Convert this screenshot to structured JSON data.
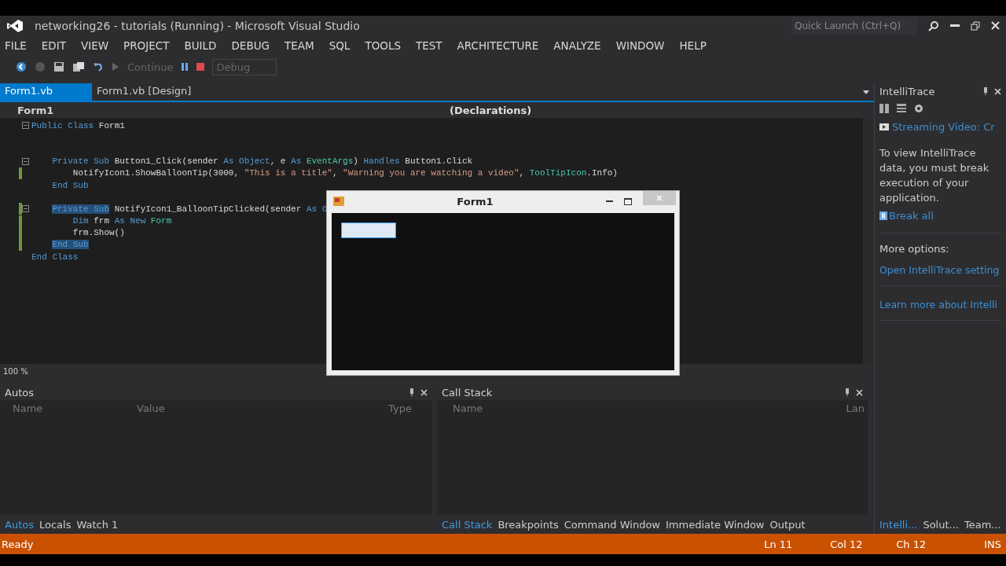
{
  "title_bar": {
    "title": "networking26 - tutorials (Running) - Microsoft Visual Studio",
    "quick_launch": {
      "placeholder": "Quick Launch (Ctrl+Q)"
    }
  },
  "menu": [
    "FILE",
    "EDIT",
    "VIEW",
    "PROJECT",
    "BUILD",
    "DEBUG",
    "TEAM",
    "SQL",
    "TOOLS",
    "TEST",
    "ARCHITECTURE",
    "ANALYZE",
    "WINDOW",
    "HELP"
  ],
  "toolbar": {
    "continue": "Continue",
    "configuration": "Debug"
  },
  "doc_tabs": [
    {
      "label": "Form1.vb",
      "selected": true
    },
    {
      "label": "Form1.vb [Design]",
      "selected": false
    }
  ],
  "nav": {
    "type": "Form1",
    "member": "(Declarations)"
  },
  "code_lines": [
    {
      "kind": "code",
      "fold": true,
      "changed": false,
      "tokens": [
        {
          "kind": "keyword",
          "text": "Public Class "
        },
        {
          "kind": "plain",
          "text": "Form1"
        }
      ]
    },
    {
      "kind": "blank"
    },
    {
      "kind": "blank"
    },
    {
      "kind": "code",
      "fold": true,
      "changed": false,
      "tokens": [
        {
          "kind": "keyword",
          "text": "    Private Sub "
        },
        {
          "kind": "plain",
          "text": "Button1_Click(sender "
        },
        {
          "kind": "keyword",
          "text": "As Object"
        },
        {
          "kind": "plain",
          "text": ", e "
        },
        {
          "kind": "keyword",
          "text": "As "
        },
        {
          "kind": "type",
          "text": "EventArgs"
        },
        {
          "kind": "plain",
          "text": ") "
        },
        {
          "kind": "keyword",
          "text": "Handles "
        },
        {
          "kind": "plain",
          "text": "Button1.Click"
        }
      ]
    },
    {
      "kind": "code",
      "fold": false,
      "changed": true,
      "tokens": [
        {
          "kind": "plain",
          "text": "        NotifyIcon1.ShowBalloonTip(3000, "
        },
        {
          "kind": "string",
          "text": "\"This is a title\""
        },
        {
          "kind": "plain",
          "text": ", "
        },
        {
          "kind": "string",
          "text": "\"Warning you are watching a video\""
        },
        {
          "kind": "plain",
          "text": ", "
        },
        {
          "kind": "type",
          "text": "ToolTipIcon"
        },
        {
          "kind": "plain",
          "text": ".Info)"
        }
      ]
    },
    {
      "kind": "code",
      "fold": false,
      "changed": false,
      "tokens": [
        {
          "kind": "keyword",
          "text": "    End Sub"
        }
      ]
    },
    {
      "kind": "blank"
    },
    {
      "kind": "code",
      "fold": true,
      "changed": true,
      "tokens": [
        {
          "kind": "selected",
          "text": "    Private Sub"
        },
        {
          "kind": "plain",
          "text": " NotifyIcon1_BalloonTipClicked(sender "
        },
        {
          "kind": "keyword",
          "text": "As O"
        }
      ]
    },
    {
      "kind": "code",
      "fold": false,
      "changed": true,
      "tokens": [
        {
          "kind": "keyword",
          "text": "        Dim "
        },
        {
          "kind": "plain",
          "text": "frm "
        },
        {
          "kind": "keyword",
          "text": "As New "
        },
        {
          "kind": "type",
          "text": "Form"
        }
      ]
    },
    {
      "kind": "code",
      "fold": false,
      "changed": true,
      "tokens": [
        {
          "kind": "plain",
          "text": "        frm.Show()"
        }
      ]
    },
    {
      "kind": "code",
      "fold": false,
      "changed": true,
      "tokens": [
        {
          "kind": "selected",
          "text": "    End Sub"
        }
      ]
    },
    {
      "kind": "code",
      "fold": false,
      "changed": false,
      "tokens": [
        {
          "kind": "keyword",
          "text": "End Class"
        }
      ]
    }
  ],
  "zoom": "100 %",
  "form_window": {
    "title": "Form1"
  },
  "intellitrace": {
    "title": "IntelliTrace",
    "session": "Streaming Video: Cr",
    "message": "To view IntelliTrace data, you must break execution of your application.",
    "break_link": "Break all",
    "more": "More options:",
    "links": [
      "Open IntelliTrace setting",
      "Learn more about Intelli"
    ]
  },
  "autos": {
    "title": "Autos",
    "columns": [
      "Name",
      "Value",
      "Type"
    ],
    "tabs": [
      {
        "label": "Autos",
        "selected": true
      },
      {
        "label": "Locals",
        "selected": false
      },
      {
        "label": "Watch 1",
        "selected": false
      }
    ]
  },
  "call_stack": {
    "title": "Call Stack",
    "columns": [
      "Name",
      "Lan"
    ],
    "tabs": [
      {
        "label": "Call Stack",
        "selected": true
      },
      {
        "label": "Breakpoints",
        "selected": false
      },
      {
        "label": "Command Window",
        "selected": false
      },
      {
        "label": "Immediate Window",
        "selected": false
      },
      {
        "label": "Output",
        "selected": false
      }
    ]
  },
  "side_tabs": [
    {
      "label": "Intelli...",
      "selected": true
    },
    {
      "label": "Solut...",
      "selected": false
    },
    {
      "label": "Team...",
      "selected": false
    }
  ],
  "status_bar": {
    "message": "Ready",
    "line": "Ln 11",
    "column": "Col 12",
    "char": "Ch 12",
    "mode": "INS"
  }
}
